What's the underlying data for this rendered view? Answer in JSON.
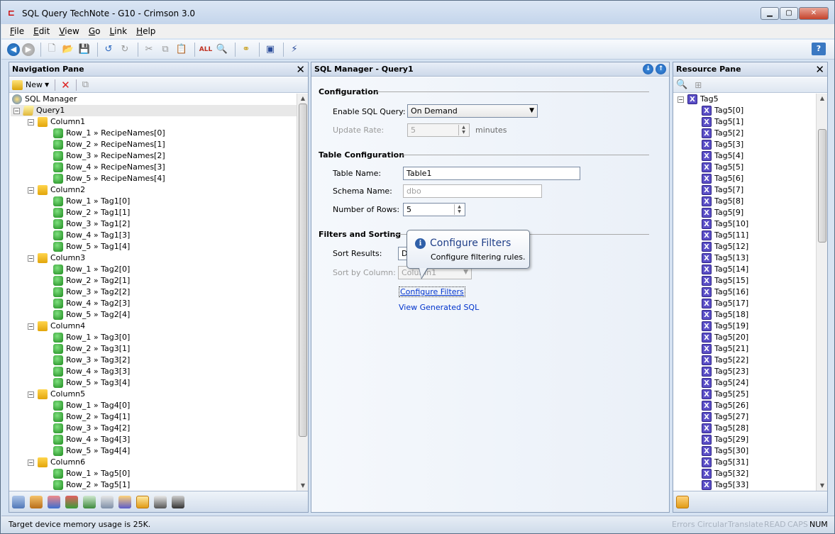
{
  "window": {
    "title": "SQL Query TechNote - G10 - Crimson 3.0"
  },
  "menu": [
    "File",
    "Edit",
    "View",
    "Go",
    "Link",
    "Help"
  ],
  "nav_pane": {
    "title": "Navigation Pane",
    "new_label": "New",
    "tree": [
      {
        "label": "SQL Manager",
        "level": 0,
        "icon": "db",
        "exp": ""
      },
      {
        "label": "Query1",
        "level": 1,
        "icon": "query",
        "exp": "-"
      },
      {
        "label": "Column1",
        "level": 2,
        "icon": "folder",
        "exp": "-"
      },
      {
        "label": "Row_1 » RecipeNames[0]",
        "level": 3,
        "icon": "green",
        "exp": ""
      },
      {
        "label": "Row_2 » RecipeNames[1]",
        "level": 3,
        "icon": "green",
        "exp": ""
      },
      {
        "label": "Row_3 » RecipeNames[2]",
        "level": 3,
        "icon": "green",
        "exp": ""
      },
      {
        "label": "Row_4 » RecipeNames[3]",
        "level": 3,
        "icon": "green",
        "exp": ""
      },
      {
        "label": "Row_5 » RecipeNames[4]",
        "level": 3,
        "icon": "green",
        "exp": ""
      },
      {
        "label": "Column2",
        "level": 2,
        "icon": "folder",
        "exp": "-"
      },
      {
        "label": "Row_1 » Tag1[0]",
        "level": 3,
        "icon": "green",
        "exp": ""
      },
      {
        "label": "Row_2 » Tag1[1]",
        "level": 3,
        "icon": "green",
        "exp": ""
      },
      {
        "label": "Row_3 » Tag1[2]",
        "level": 3,
        "icon": "green",
        "exp": ""
      },
      {
        "label": "Row_4 » Tag1[3]",
        "level": 3,
        "icon": "green",
        "exp": ""
      },
      {
        "label": "Row_5 » Tag1[4]",
        "level": 3,
        "icon": "green",
        "exp": ""
      },
      {
        "label": "Column3",
        "level": 2,
        "icon": "folder",
        "exp": "-"
      },
      {
        "label": "Row_1 » Tag2[0]",
        "level": 3,
        "icon": "green",
        "exp": ""
      },
      {
        "label": "Row_2 » Tag2[1]",
        "level": 3,
        "icon": "green",
        "exp": ""
      },
      {
        "label": "Row_3 » Tag2[2]",
        "level": 3,
        "icon": "green",
        "exp": ""
      },
      {
        "label": "Row_4 » Tag2[3]",
        "level": 3,
        "icon": "green",
        "exp": ""
      },
      {
        "label": "Row_5 » Tag2[4]",
        "level": 3,
        "icon": "green",
        "exp": ""
      },
      {
        "label": "Column4",
        "level": 2,
        "icon": "folder",
        "exp": "-"
      },
      {
        "label": "Row_1 » Tag3[0]",
        "level": 3,
        "icon": "green",
        "exp": ""
      },
      {
        "label": "Row_2 » Tag3[1]",
        "level": 3,
        "icon": "green",
        "exp": ""
      },
      {
        "label": "Row_3 » Tag3[2]",
        "level": 3,
        "icon": "green",
        "exp": ""
      },
      {
        "label": "Row_4 » Tag3[3]",
        "level": 3,
        "icon": "green",
        "exp": ""
      },
      {
        "label": "Row_5 » Tag3[4]",
        "level": 3,
        "icon": "green",
        "exp": ""
      },
      {
        "label": "Column5",
        "level": 2,
        "icon": "folder",
        "exp": "-"
      },
      {
        "label": "Row_1 » Tag4[0]",
        "level": 3,
        "icon": "green",
        "exp": ""
      },
      {
        "label": "Row_2 » Tag4[1]",
        "level": 3,
        "icon": "green",
        "exp": ""
      },
      {
        "label": "Row_3 » Tag4[2]",
        "level": 3,
        "icon": "green",
        "exp": ""
      },
      {
        "label": "Row_4 » Tag4[3]",
        "level": 3,
        "icon": "green",
        "exp": ""
      },
      {
        "label": "Row_5 » Tag4[4]",
        "level": 3,
        "icon": "green",
        "exp": ""
      },
      {
        "label": "Column6",
        "level": 2,
        "icon": "folder",
        "exp": "-"
      },
      {
        "label": "Row_1 » Tag5[0]",
        "level": 3,
        "icon": "green",
        "exp": ""
      },
      {
        "label": "Row_2 » Tag5[1]",
        "level": 3,
        "icon": "green",
        "exp": ""
      }
    ]
  },
  "sql_manager": {
    "title": "SQL Manager - Query1",
    "configuration": {
      "section": "Configuration",
      "enable_label": "Enable SQL Query:",
      "enable_value": "On Demand",
      "rate_label": "Update Rate:",
      "rate_value": "5",
      "rate_unit": "minutes"
    },
    "table_configuration": {
      "section": "Table Configuration",
      "table_name_label": "Table Name:",
      "table_name_value": "Table1",
      "schema_label": "Schema Name:",
      "schema_value": "dbo",
      "rows_label": "Number of Rows:",
      "rows_value": "5"
    },
    "filters": {
      "section": "Filters and Sorting",
      "sort_label": "Sort Results:",
      "sort_value": "D",
      "sortcol_label": "Sort by Column:",
      "sortcol_value": "Column1",
      "configure_link": "Configure Filters",
      "generated_link": "View Generated SQL"
    },
    "tooltip": {
      "title": "Configure Filters",
      "body": "Configure filtering rules."
    }
  },
  "resource_pane": {
    "title": "Resource Pane",
    "root": "Tag5",
    "items": [
      "Tag5[0]",
      "Tag5[1]",
      "Tag5[2]",
      "Tag5[3]",
      "Tag5[4]",
      "Tag5[5]",
      "Tag5[6]",
      "Tag5[7]",
      "Tag5[8]",
      "Tag5[9]",
      "Tag5[10]",
      "Tag5[11]",
      "Tag5[12]",
      "Tag5[13]",
      "Tag5[14]",
      "Tag5[15]",
      "Tag5[16]",
      "Tag5[17]",
      "Tag5[18]",
      "Tag5[19]",
      "Tag5[20]",
      "Tag5[21]",
      "Tag5[22]",
      "Tag5[23]",
      "Tag5[24]",
      "Tag5[25]",
      "Tag5[26]",
      "Tag5[27]",
      "Tag5[28]",
      "Tag5[29]",
      "Tag5[30]",
      "Tag5[31]",
      "Tag5[32]",
      "Tag5[33]"
    ]
  },
  "status": {
    "text": "Target device memory usage is 25K.",
    "indicators": [
      {
        "label": "Errors",
        "on": false
      },
      {
        "label": "Circular",
        "on": false
      },
      {
        "label": "Translate",
        "on": false
      },
      {
        "label": "READ",
        "on": false
      },
      {
        "label": "CAPS",
        "on": false
      },
      {
        "label": "NUM",
        "on": true
      }
    ]
  }
}
